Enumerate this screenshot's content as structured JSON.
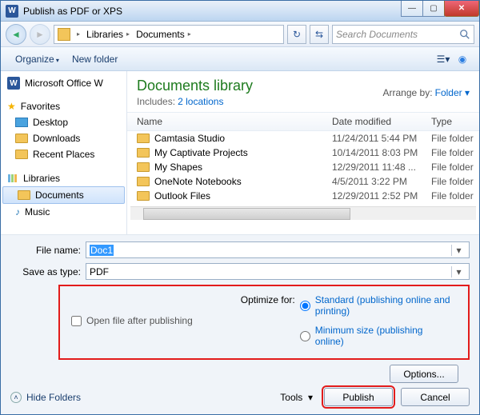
{
  "titlebar": {
    "app_glyph": "W",
    "title": "Publish as PDF or XPS"
  },
  "nav": {
    "breadcrumb": [
      "Libraries",
      "Documents"
    ],
    "refresh_glyph": "↻",
    "swap_glyph": "⇆",
    "search_placeholder": "Search Documents"
  },
  "toolbar": {
    "organize": "Organize",
    "new_folder": "New folder"
  },
  "sidebar": {
    "app_label": "Microsoft Office W",
    "favorites": "Favorites",
    "fav_items": [
      "Desktop",
      "Downloads",
      "Recent Places"
    ],
    "libraries": "Libraries",
    "lib_items": [
      "Documents",
      "Music"
    ]
  },
  "library_header": {
    "title": "Documents library",
    "includes_label": "Includes:",
    "includes_link": "2 locations",
    "arrange_label": "Arrange by:",
    "arrange_value": "Folder ▾"
  },
  "columns": {
    "name": "Name",
    "date": "Date modified",
    "type": "Type"
  },
  "files": [
    {
      "name": "Camtasia Studio",
      "date": "11/24/2011 5:44 PM",
      "type": "File folder"
    },
    {
      "name": "My Captivate Projects",
      "date": "10/14/2011 8:03 PM",
      "type": "File folder"
    },
    {
      "name": "My Shapes",
      "date": "12/29/2011 11:48 ...",
      "type": "File folder"
    },
    {
      "name": "OneNote Notebooks",
      "date": "4/5/2011 3:22 PM",
      "type": "File folder"
    },
    {
      "name": "Outlook Files",
      "date": "12/29/2011 2:52 PM",
      "type": "File folder"
    }
  ],
  "fields": {
    "file_name_label": "File name:",
    "file_name_value": "Doc1",
    "save_type_label": "Save as type:",
    "save_type_value": "PDF"
  },
  "options": {
    "open_after": "Open file after publishing",
    "optimize_label": "Optimize for:",
    "standard": "Standard (publishing online and printing)",
    "minimum": "Minimum size (publishing online)",
    "options_btn": "Options..."
  },
  "footer": {
    "hide": "Hide Folders",
    "tools": "Tools",
    "publish": "Publish",
    "cancel": "Cancel"
  }
}
